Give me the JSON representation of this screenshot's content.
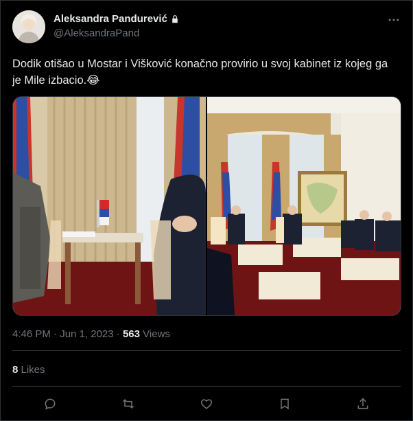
{
  "author": {
    "name": "Aleksandra Pandurević",
    "handle": "@AleksandraPand",
    "protected_icon": "lock-icon"
  },
  "tweet": {
    "text": "Dodik otišao u Mostar i Višković konačno provirio u svoj kabinet iz kojeg ga je Mile izbacio.😂"
  },
  "meta": {
    "time": "4:46 PM",
    "separator": " · ",
    "date": "Jun 1, 2023",
    "separator2": " · ",
    "views_count": "563",
    "views_label": " Views"
  },
  "stats": {
    "likes_count": "8",
    "likes_label": " Likes"
  },
  "actions": [
    "reply-icon",
    "retweet-icon",
    "like-icon",
    "bookmark-icon",
    "share-icon"
  ],
  "colors": {
    "bg": "#000000",
    "text": "#e7e9ea",
    "muted": "#71767b",
    "border": "#2f3336"
  }
}
